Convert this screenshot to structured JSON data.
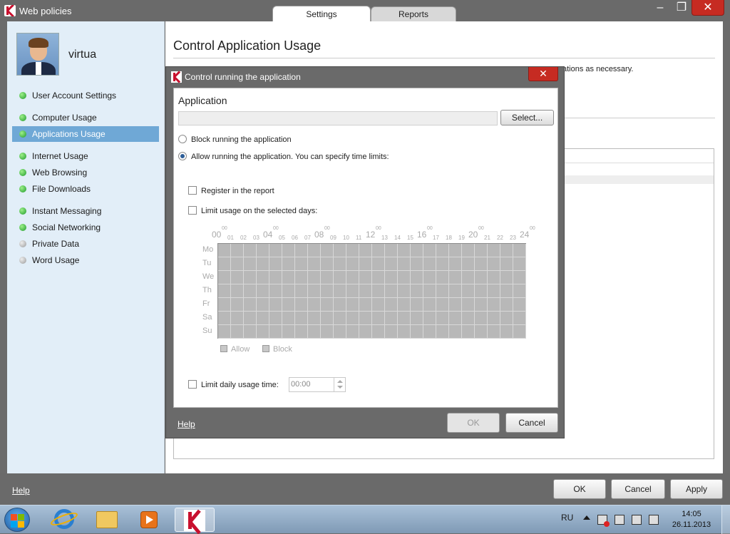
{
  "window": {
    "title": "Web policies",
    "tabs": [
      "Settings",
      "Reports"
    ],
    "controls": {
      "minimize": "–",
      "maximize": "❐",
      "close": "✕"
    }
  },
  "sidebar": {
    "user_name": "virtua",
    "items": [
      {
        "label": "User Account Settings",
        "status": "green"
      },
      {
        "label": "Computer Usage",
        "status": "green"
      },
      {
        "label": "Applications Usage",
        "status": "green",
        "active": true
      },
      {
        "label": "Internet Usage",
        "status": "green"
      },
      {
        "label": "Web Browsing",
        "status": "green"
      },
      {
        "label": "File Downloads",
        "status": "green"
      },
      {
        "label": "Instant Messaging",
        "status": "green"
      },
      {
        "label": "Social Networking",
        "status": "green"
      },
      {
        "label": "Private Data",
        "status": "gray"
      },
      {
        "label": "Word Usage",
        "status": "gray"
      }
    ]
  },
  "main": {
    "title": "Control Application Usage",
    "description_fragment": "ations as necessary."
  },
  "bottom": {
    "help": "Help",
    "ok": "OK",
    "cancel": "Cancel",
    "apply": "Apply"
  },
  "dialog": {
    "title": "Control running the application",
    "close": "✕",
    "section_title": "Application",
    "application_value": "",
    "select_button": "Select...",
    "radio_block": "Block running the application",
    "radio_allow": "Allow running the application. You can specify time limits:",
    "selected_radio": "allow",
    "register_in_report": "Register in the report",
    "register_checked": false,
    "limit_days": "Limit usage on the selected days:",
    "limit_days_checked": false,
    "schedule": {
      "days": [
        "Mo",
        "Tu",
        "We",
        "Th",
        "Fr",
        "Sa",
        "Su"
      ],
      "hour_major": [
        "00",
        "04",
        "08",
        "12",
        "16",
        "20",
        "24"
      ],
      "hour_minor": [
        "01",
        "02",
        "03",
        "05",
        "06",
        "07",
        "09",
        "10",
        "11",
        "13",
        "14",
        "15",
        "17",
        "18",
        "19",
        "21",
        "22",
        "23"
      ],
      "minute_superscript": "00",
      "legend_allow": "Allow",
      "legend_block": "Block"
    },
    "limit_daily": "Limit daily usage time:",
    "limit_daily_checked": false,
    "daily_time": "00:00",
    "help": "Help",
    "ok": "OK",
    "cancel": "Cancel",
    "ok_enabled": false
  },
  "taskbar": {
    "language": "RU",
    "time": "14:05",
    "date": "26.11.2013",
    "pinned": [
      "start-button",
      "internet-explorer",
      "windows-explorer",
      "media-player",
      "kaspersky"
    ]
  },
  "colors": {
    "accent": "#6fa8d6",
    "close_red": "#c62b22",
    "status_green": "#1e9a2a",
    "status_gray": "#999999",
    "chrome_gray": "#6a6a6a"
  }
}
